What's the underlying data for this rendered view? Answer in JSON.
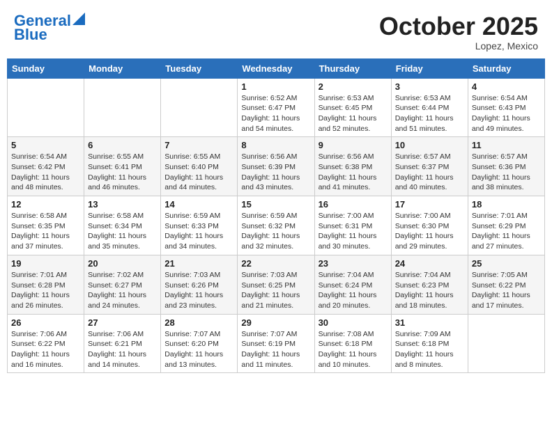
{
  "header": {
    "logo_line1": "General",
    "logo_line2": "Blue",
    "month": "October 2025",
    "location": "Lopez, Mexico"
  },
  "days_of_week": [
    "Sunday",
    "Monday",
    "Tuesday",
    "Wednesday",
    "Thursday",
    "Friday",
    "Saturday"
  ],
  "weeks": [
    [
      {
        "day": "",
        "info": ""
      },
      {
        "day": "",
        "info": ""
      },
      {
        "day": "",
        "info": ""
      },
      {
        "day": "1",
        "info": "Sunrise: 6:52 AM\nSunset: 6:47 PM\nDaylight: 11 hours\nand 54 minutes."
      },
      {
        "day": "2",
        "info": "Sunrise: 6:53 AM\nSunset: 6:45 PM\nDaylight: 11 hours\nand 52 minutes."
      },
      {
        "day": "3",
        "info": "Sunrise: 6:53 AM\nSunset: 6:44 PM\nDaylight: 11 hours\nand 51 minutes."
      },
      {
        "day": "4",
        "info": "Sunrise: 6:54 AM\nSunset: 6:43 PM\nDaylight: 11 hours\nand 49 minutes."
      }
    ],
    [
      {
        "day": "5",
        "info": "Sunrise: 6:54 AM\nSunset: 6:42 PM\nDaylight: 11 hours\nand 48 minutes."
      },
      {
        "day": "6",
        "info": "Sunrise: 6:55 AM\nSunset: 6:41 PM\nDaylight: 11 hours\nand 46 minutes."
      },
      {
        "day": "7",
        "info": "Sunrise: 6:55 AM\nSunset: 6:40 PM\nDaylight: 11 hours\nand 44 minutes."
      },
      {
        "day": "8",
        "info": "Sunrise: 6:56 AM\nSunset: 6:39 PM\nDaylight: 11 hours\nand 43 minutes."
      },
      {
        "day": "9",
        "info": "Sunrise: 6:56 AM\nSunset: 6:38 PM\nDaylight: 11 hours\nand 41 minutes."
      },
      {
        "day": "10",
        "info": "Sunrise: 6:57 AM\nSunset: 6:37 PM\nDaylight: 11 hours\nand 40 minutes."
      },
      {
        "day": "11",
        "info": "Sunrise: 6:57 AM\nSunset: 6:36 PM\nDaylight: 11 hours\nand 38 minutes."
      }
    ],
    [
      {
        "day": "12",
        "info": "Sunrise: 6:58 AM\nSunset: 6:35 PM\nDaylight: 11 hours\nand 37 minutes."
      },
      {
        "day": "13",
        "info": "Sunrise: 6:58 AM\nSunset: 6:34 PM\nDaylight: 11 hours\nand 35 minutes."
      },
      {
        "day": "14",
        "info": "Sunrise: 6:59 AM\nSunset: 6:33 PM\nDaylight: 11 hours\nand 34 minutes."
      },
      {
        "day": "15",
        "info": "Sunrise: 6:59 AM\nSunset: 6:32 PM\nDaylight: 11 hours\nand 32 minutes."
      },
      {
        "day": "16",
        "info": "Sunrise: 7:00 AM\nSunset: 6:31 PM\nDaylight: 11 hours\nand 30 minutes."
      },
      {
        "day": "17",
        "info": "Sunrise: 7:00 AM\nSunset: 6:30 PM\nDaylight: 11 hours\nand 29 minutes."
      },
      {
        "day": "18",
        "info": "Sunrise: 7:01 AM\nSunset: 6:29 PM\nDaylight: 11 hours\nand 27 minutes."
      }
    ],
    [
      {
        "day": "19",
        "info": "Sunrise: 7:01 AM\nSunset: 6:28 PM\nDaylight: 11 hours\nand 26 minutes."
      },
      {
        "day": "20",
        "info": "Sunrise: 7:02 AM\nSunset: 6:27 PM\nDaylight: 11 hours\nand 24 minutes."
      },
      {
        "day": "21",
        "info": "Sunrise: 7:03 AM\nSunset: 6:26 PM\nDaylight: 11 hours\nand 23 minutes."
      },
      {
        "day": "22",
        "info": "Sunrise: 7:03 AM\nSunset: 6:25 PM\nDaylight: 11 hours\nand 21 minutes."
      },
      {
        "day": "23",
        "info": "Sunrise: 7:04 AM\nSunset: 6:24 PM\nDaylight: 11 hours\nand 20 minutes."
      },
      {
        "day": "24",
        "info": "Sunrise: 7:04 AM\nSunset: 6:23 PM\nDaylight: 11 hours\nand 18 minutes."
      },
      {
        "day": "25",
        "info": "Sunrise: 7:05 AM\nSunset: 6:22 PM\nDaylight: 11 hours\nand 17 minutes."
      }
    ],
    [
      {
        "day": "26",
        "info": "Sunrise: 7:06 AM\nSunset: 6:22 PM\nDaylight: 11 hours\nand 16 minutes."
      },
      {
        "day": "27",
        "info": "Sunrise: 7:06 AM\nSunset: 6:21 PM\nDaylight: 11 hours\nand 14 minutes."
      },
      {
        "day": "28",
        "info": "Sunrise: 7:07 AM\nSunset: 6:20 PM\nDaylight: 11 hours\nand 13 minutes."
      },
      {
        "day": "29",
        "info": "Sunrise: 7:07 AM\nSunset: 6:19 PM\nDaylight: 11 hours\nand 11 minutes."
      },
      {
        "day": "30",
        "info": "Sunrise: 7:08 AM\nSunset: 6:18 PM\nDaylight: 11 hours\nand 10 minutes."
      },
      {
        "day": "31",
        "info": "Sunrise: 7:09 AM\nSunset: 6:18 PM\nDaylight: 11 hours\nand 8 minutes."
      },
      {
        "day": "",
        "info": ""
      }
    ]
  ]
}
